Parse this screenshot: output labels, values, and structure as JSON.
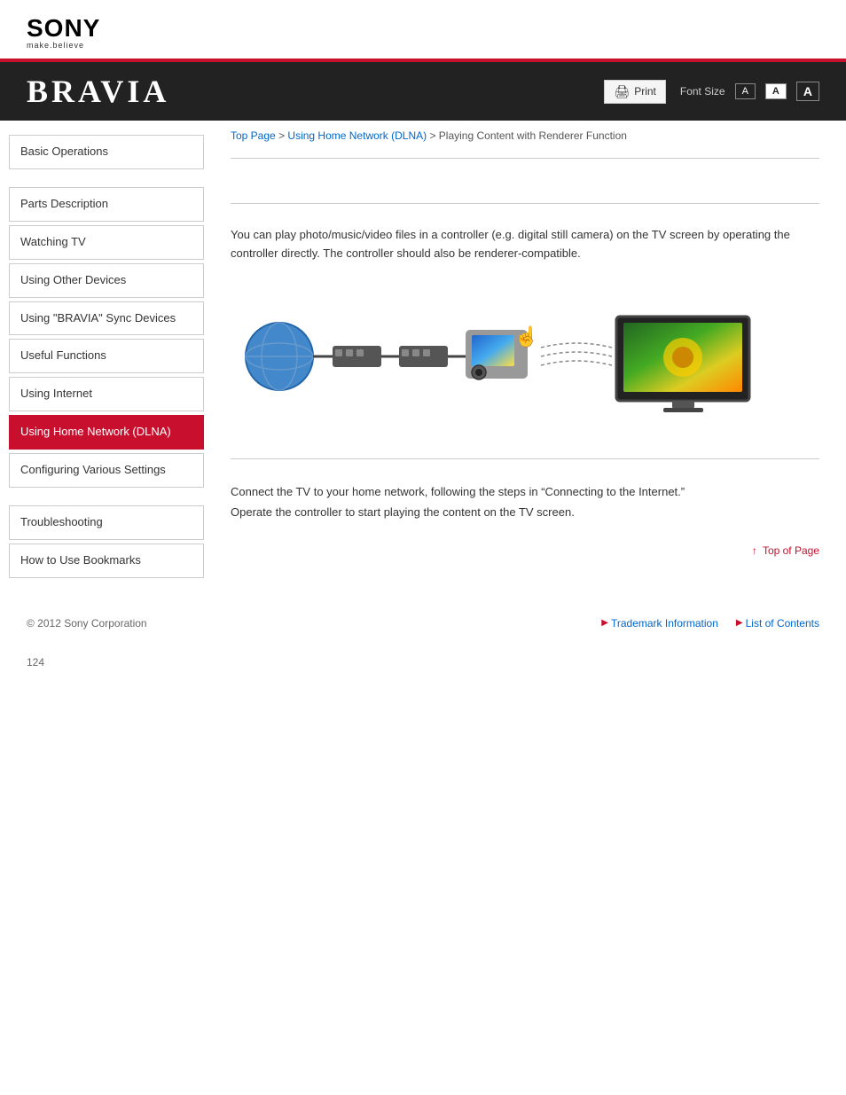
{
  "header": {
    "sony_text": "SONY",
    "sony_tagline": "make.believe",
    "bravia_title": "BRAVIA",
    "print_label": "Print",
    "font_size_label": "Font Size",
    "font_small": "A",
    "font_medium": "A",
    "font_large": "A"
  },
  "breadcrumb": {
    "top_page": "Top Page",
    "separator1": " > ",
    "home_network": "Using Home Network (DLNA)",
    "separator2": " >  ",
    "current": "Playing Content with Renderer Function"
  },
  "sidebar": {
    "items": [
      {
        "id": "basic-operations",
        "label": "Basic Operations",
        "active": false
      },
      {
        "id": "parts-description",
        "label": "Parts Description",
        "active": false
      },
      {
        "id": "watching-tv",
        "label": "Watching TV",
        "active": false
      },
      {
        "id": "using-other-devices",
        "label": "Using Other Devices",
        "active": false
      },
      {
        "id": "using-bravia-sync",
        "label": "Using \"BRAVIA\" Sync Devices",
        "active": false
      },
      {
        "id": "useful-functions",
        "label": "Useful Functions",
        "active": false
      },
      {
        "id": "using-internet",
        "label": "Using Internet",
        "active": false
      },
      {
        "id": "using-home-network",
        "label": "Using Home Network (DLNA)",
        "active": true
      },
      {
        "id": "configuring-settings",
        "label": "Configuring Various Settings",
        "active": false
      },
      {
        "id": "troubleshooting",
        "label": "Troubleshooting",
        "active": false
      },
      {
        "id": "how-to-use-bookmarks",
        "label": "How to Use Bookmarks",
        "active": false
      }
    ]
  },
  "content": {
    "intro_text": "You can play photo/music/video files in a controller (e.g. digital still camera) on the TV screen by operating the controller directly. The controller should also be renderer-compatible.",
    "steps_text_1": "Connect the TV to your home network, following the steps in “Connecting to the Internet.”",
    "steps_text_2": "Operate the controller to start playing the content on the TV screen."
  },
  "footer": {
    "top_of_page": "Top of Page",
    "copyright": "© 2012 Sony Corporation",
    "trademark": "Trademark Information",
    "list_of_contents": "List of Contents"
  },
  "page_number": "124"
}
